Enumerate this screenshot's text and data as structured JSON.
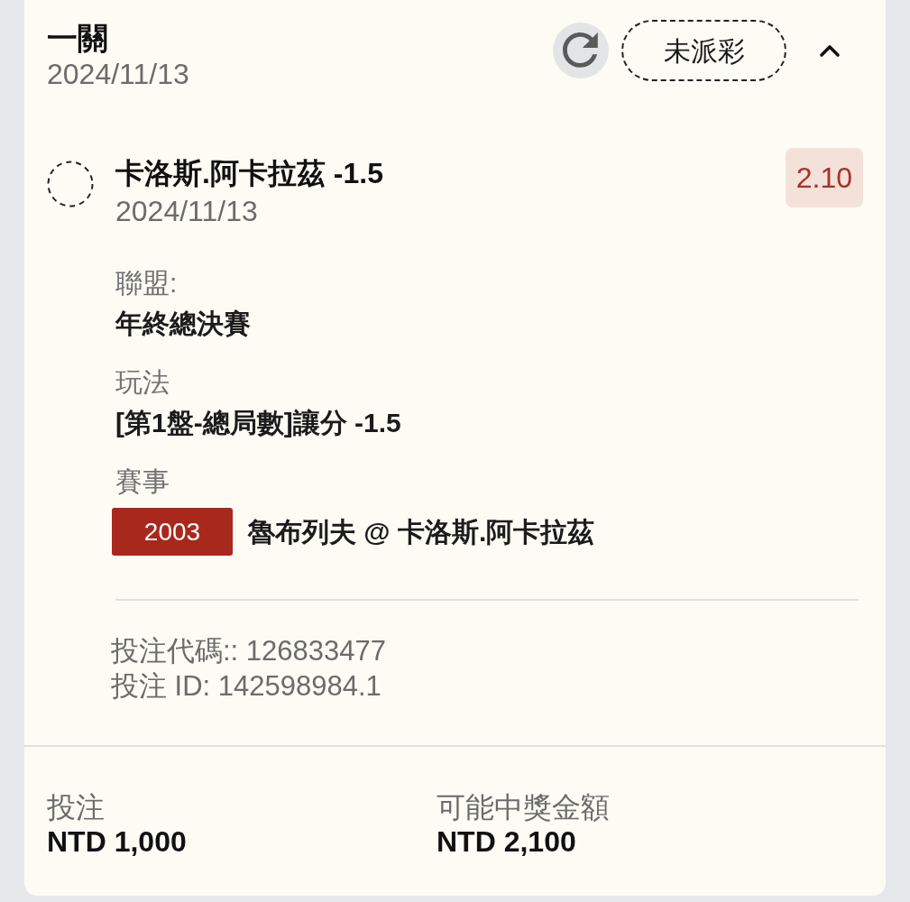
{
  "bet": {
    "type": "一關",
    "date": "2024/11/13",
    "status": "未派彩",
    "expanded": true
  },
  "selection": {
    "name": "卡洛斯.阿卡拉茲 -1.5",
    "date": "2024/11/13",
    "odds": "2.10"
  },
  "details": [
    {
      "kind": "text",
      "label": "聯盟:",
      "value": "年終總決賽"
    },
    {
      "kind": "text",
      "label": "玩法",
      "value": "[第1盤-總局數]讓分 -1.5"
    },
    {
      "kind": "event",
      "label": "賽事",
      "code": "2003",
      "value": "魯布列夫 @ 卡洛斯.阿卡拉茲"
    }
  ],
  "ids": [
    "投注代碼:: 126833477",
    "投注 ID: 142598984.1"
  ],
  "summary": [
    {
      "label": "投注",
      "value": "NTD 1,000"
    },
    {
      "label": "可能中獎金額",
      "value": "NTD 2,100"
    }
  ]
}
